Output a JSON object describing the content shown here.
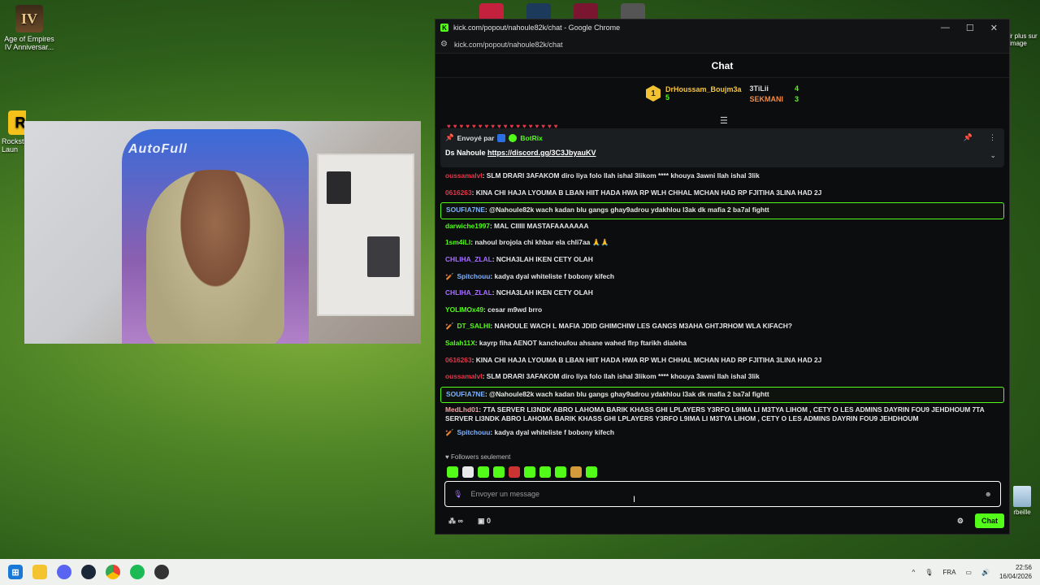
{
  "desktop": {
    "icons": [
      {
        "label": "Age of Empires IV Anniversar...",
        "glyph": "IV"
      },
      {
        "label": "Rocksta Laun",
        "glyph": "R"
      }
    ],
    "right_icon_label": "ir plus sur image",
    "recycle_label": "rbeille"
  },
  "webcam": {
    "chair_text": "AutoFull"
  },
  "browser": {
    "window_title": "kick.com/popout/nahoule82k/chat - Google Chrome",
    "favicon": "K",
    "url": "kick.com/popout/nahoule82k/chat",
    "controls": {
      "minimize": "—",
      "maximize": "☐",
      "close": "✕"
    }
  },
  "chat": {
    "header": "Chat",
    "leaderboard": {
      "first": {
        "rank": "1",
        "name": "DrHoussam_Boujm3a",
        "count": "5"
      },
      "others": [
        {
          "name": "3TiLii",
          "count": "4"
        },
        {
          "name": "SEKMANI",
          "count": "3"
        }
      ]
    },
    "pinned": {
      "sent_by": "Envoyé par",
      "bot_name": "BotRix",
      "body_prefix": "Ds Nahoule",
      "link": "https://discord.gg/3C3JbyauKV"
    },
    "messages": [
      {
        "user": "oussamalvl",
        "color": "#e8364a",
        "text": ": SLM DRARI 3AFAKOM diro liya folo llah ishal 3likom **** khouya 3awni llah ishal 3lik",
        "badge": "",
        "highlight": false
      },
      {
        "user": "0616263",
        "color": "#e8364a",
        "text": ": KINA CHI HAJA LYOUMA B LBAN HIIT HADA HWA RP WLH CHHAL MCHAN HAD RP FJITIHA 3LINA HAD 2J",
        "badge": "",
        "highlight": false
      },
      {
        "user": "SOUFIA7NE",
        "color": "#7fb2ff",
        "text": ": @Nahoule82k wach kadan blu gangs ghay9adrou ydakhlou l3ak dk mafia 2 ba7al fightt",
        "badge": "",
        "highlight": true
      },
      {
        "user": "darwiche1997",
        "color": "#53fc18",
        "text": ": MAL CIIIII MASTAFAAAAAAA",
        "badge": "",
        "highlight": false
      },
      {
        "user": "1sm4iLl",
        "color": "#53fc18",
        "text": ": nahoul brojola chi khbar ela chli7aa 🙏🙏",
        "badge": "",
        "highlight": false
      },
      {
        "user": "CHLIHA_ZLAL",
        "color": "#a970ff",
        "text": ": NCHA3LAH IKEN CETY OLAH",
        "badge": "",
        "highlight": false
      },
      {
        "user": "Spitchouu",
        "color": "#7fb2ff",
        "text": ": kadya dyal whiteliste f bobony kifech",
        "badge": "🏏",
        "highlight": false
      },
      {
        "user": "CHLIHA_ZLAL",
        "color": "#a970ff",
        "text": ": NCHA3LAH IKEN CETY OLAH",
        "badge": "",
        "highlight": false
      },
      {
        "user": "YOLIMOx49",
        "color": "#53fc18",
        "text": ": cesar m9wd brro",
        "badge": "",
        "highlight": false
      },
      {
        "user": "DT_SALHI",
        "color": "#53fc18",
        "text": ": NAHOULE WACH L MAFIA JDID GHIMCHIW LES GANGS M3AHA GHTJRHOM WLA KIFACH?",
        "badge": "🏏",
        "highlight": false
      },
      {
        "user": "Salah11X",
        "color": "#53fc18",
        "text": ": kayrp fiha AENOT kanchoufou ahsane wahed flrp ftarikh dialeha",
        "badge": "",
        "highlight": false
      },
      {
        "user": "0616263",
        "color": "#e8364a",
        "text": ": KINA CHI HAJA LYOUMA B LBAN HIIT HADA HWA RP WLH CHHAL MCHAN HAD RP FJITIHA 3LINA HAD 2J",
        "badge": "",
        "highlight": false
      },
      {
        "user": "oussamalvl",
        "color": "#e8364a",
        "text": ": SLM DRARI 3AFAKOM diro liya folo llah ishal 3likom **** khouya 3awni llah ishal 3lik",
        "badge": "",
        "highlight": false
      },
      {
        "user": "SOUFIA7NE",
        "color": "#7fb2ff",
        "text": ": @Nahoule82k wach kadan blu gangs ghay9adrou ydakhlou l3ak dk mafia 2 ba7al fightt",
        "badge": "",
        "highlight": true
      },
      {
        "user": "MedLhd01",
        "color": "#f5a3a3",
        "text": ": 7TA SERVER LI3NDK ABRO LAHOMA BARIK KHASS GHI LPLAYERS Y3RFO L9IMA LI M3TYA LIHOM , CETY O LES ADMINS DAYRIN FOU9 JEHDHOUM 7TA SERVER LI3NDK ABRO LAHOMA BARIK KHASS GHI LPLAYERS Y3RFO L9IMA LI M3TYA LIHOM , CETY O LES ADMINS DAYRIN FOU9 JEHDHOUM",
        "badge": "",
        "highlight": false
      },
      {
        "user": "Spitchouu",
        "color": "#7fb2ff",
        "text": ": kadya dyal whiteliste f bobony kifech",
        "badge": "🏏",
        "highlight": false
      }
    ],
    "followers_only": "Followers seulement",
    "input_placeholder": "Envoyer un message",
    "bottom": {
      "infinity": "∞",
      "count": "0",
      "chat_button": "Chat"
    }
  },
  "taskbar": {
    "language": "FRA",
    "time": "22:56",
    "date": "16/04/2026"
  },
  "colors": {
    "accent": "#53fc18",
    "taskbar_bg": "#eef1ee"
  }
}
